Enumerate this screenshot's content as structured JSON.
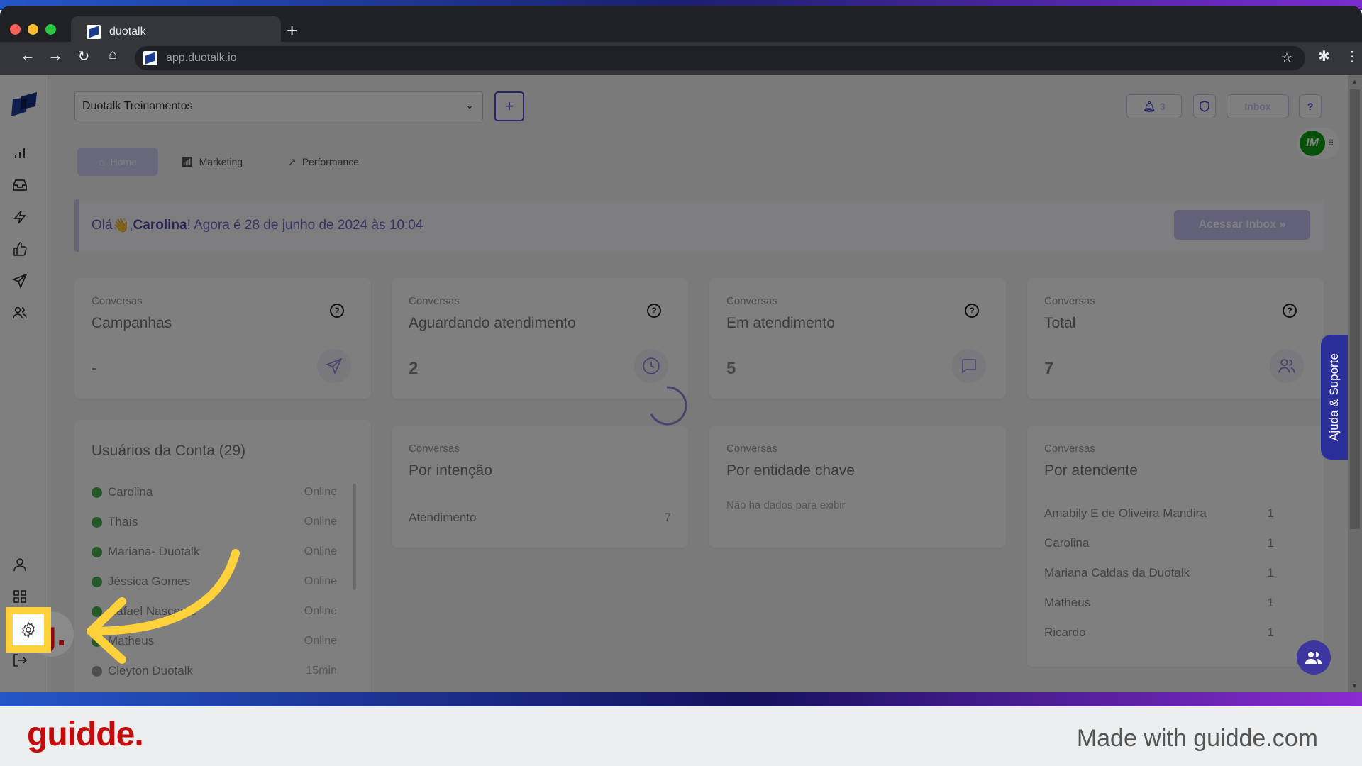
{
  "browser": {
    "tab_title": "duotalk",
    "new_tab_label": "+",
    "url": "app.duotalk.io"
  },
  "header": {
    "account_select": "Duotalk Treinamentos",
    "add_label": "+",
    "notifications_count": "3",
    "inbox_label": "Inbox",
    "help_label": "?",
    "avatar_initials": "IM"
  },
  "tabs": [
    {
      "label": "Home",
      "active": true
    },
    {
      "label": "Marketing",
      "active": false
    },
    {
      "label": "Performance",
      "active": false
    }
  ],
  "greeting": {
    "prefix": "Olá ",
    "emoji": "👋",
    "comma": ", ",
    "name": "Carolina",
    "suffix": "! Agora é 28 de junho de 2024 às 10:04",
    "button": "Acessar Inbox »"
  },
  "stats": [
    {
      "label": "Conversas",
      "title": "Campanhas",
      "value": "-",
      "icon": "send-icon"
    },
    {
      "label": "Conversas",
      "title": "Aguardando atendimento",
      "value": "2",
      "icon": "clock-icon"
    },
    {
      "label": "Conversas",
      "title": "Em atendimento",
      "value": "5",
      "icon": "chat-icon"
    },
    {
      "label": "Conversas",
      "title": "Total",
      "value": "7",
      "icon": "users-icon"
    }
  ],
  "users": {
    "title": "Usuários da Conta (29)",
    "items": [
      {
        "name": "Carolina",
        "status": "Online",
        "color": "#4caf50"
      },
      {
        "name": "Thaís",
        "status": "Online",
        "color": "#4caf50"
      },
      {
        "name": "Mariana- Duotalk",
        "status": "Online",
        "color": "#4caf50"
      },
      {
        "name": "Jéssica Gomes",
        "status": "Online",
        "color": "#4caf50"
      },
      {
        "name": "Rafael Nascente",
        "status": "Online",
        "color": "#4caf50"
      },
      {
        "name": "Matheus",
        "status": "Online",
        "color": "#4caf50"
      },
      {
        "name": "Cleyton Duotalk",
        "status": "15min",
        "color": "#9e9e9e"
      }
    ]
  },
  "intencao": {
    "label": "Conversas",
    "title": "Por intenção",
    "rows": [
      {
        "name": "Atendimento",
        "value": "7"
      }
    ]
  },
  "entidade": {
    "label": "Conversas",
    "title": "Por entidade chave",
    "empty": "Não há dados para exibir"
  },
  "atendente": {
    "label": "Conversas",
    "title": "Por atendente",
    "rows": [
      {
        "name": "Amabily E de Oliveira Mandira",
        "value": "1"
      },
      {
        "name": "Carolina",
        "value": "1"
      },
      {
        "name": "Mariana Caldas da Duotalk",
        "value": "1"
      },
      {
        "name": "Matheus",
        "value": "1"
      },
      {
        "name": "Ricardo",
        "value": "1"
      }
    ]
  },
  "help_tab": "Ajuda & Suporte",
  "footer": {
    "brand": "guidde.",
    "made_with": "Made with guidde.com"
  },
  "colors": {
    "accent": "#5146d8",
    "highlight": "#ffd13a",
    "brand_red": "#c40a0a"
  }
}
